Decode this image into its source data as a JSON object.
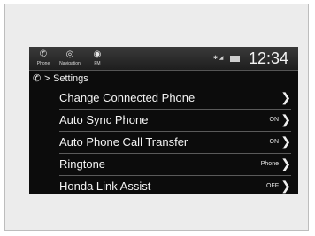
{
  "statusbar": {
    "apps": [
      {
        "label": "Phone",
        "icon": "phone-icon"
      },
      {
        "label": "Navigation",
        "icon": "compass-icon"
      },
      {
        "label": "FM",
        "icon": "radio-icon"
      }
    ],
    "clock": "12:34"
  },
  "breadcrumb": {
    "icon": "phone-icon",
    "title": "Settings"
  },
  "settings": {
    "items": [
      {
        "label": "Change Connected Phone",
        "value": ""
      },
      {
        "label": "Auto Sync Phone",
        "value": "ON"
      },
      {
        "label": "Auto Phone Call Transfer",
        "value": "ON"
      },
      {
        "label": "Ringtone",
        "value": "Phone"
      },
      {
        "label": "Honda Link Assist",
        "value": "OFF"
      }
    ]
  },
  "colors": {
    "screen_bg": "#0c0c0c",
    "text": "#f5f5f5",
    "divider": "#5a5a5a",
    "frame_bg": "#ececec"
  }
}
